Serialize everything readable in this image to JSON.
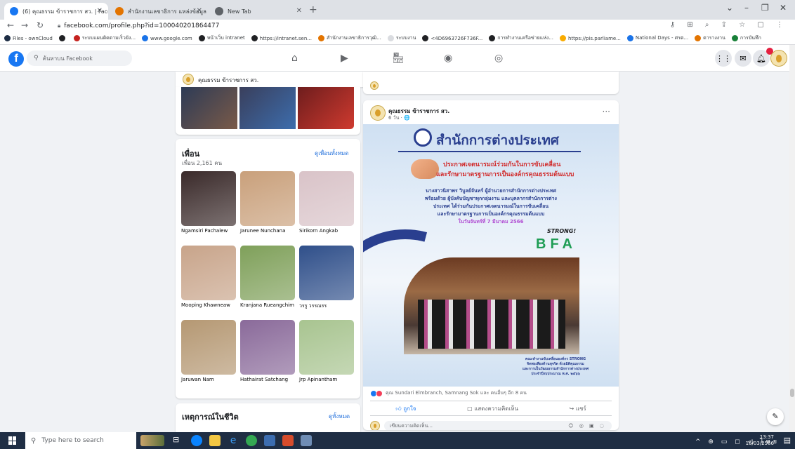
{
  "browser": {
    "tabs": [
      {
        "label": "(6) คุณธรรม ข้าราชการ สว. | Facebo",
        "active": true,
        "icon": "facebook-icon"
      },
      {
        "label": "สำนักงานเลขาธิการ แหล่งข้อมูล",
        "active": false,
        "icon": "parliament-icon"
      },
      {
        "label": "New Tab",
        "active": false,
        "icon": "chrome-icon"
      }
    ],
    "new_tab_label": "+",
    "url": "facebook.com/profile.php?id=100040201864477",
    "window_controls": [
      "⌄",
      "–",
      "❐",
      "✕"
    ],
    "bookmarks": [
      {
        "label": "Files - ownCloud",
        "color": "#1d2d44"
      },
      {
        "label": "",
        "color": "#202124"
      },
      {
        "label": "ระบบแผนติดตามเร็วยัง...",
        "color": "#c5221f"
      },
      {
        "label": "www.google.com",
        "color": "#1a73e8"
      },
      {
        "label": "หน้าเว็บ intranet",
        "color": "#202124"
      },
      {
        "label": "https://intranet.sen...",
        "color": "#202124"
      },
      {
        "label": "สำนักงานเลขาธิการวุฒิ...",
        "color": "#e37400"
      },
      {
        "label": "ระบบงาน",
        "color": "#dadce0"
      },
      {
        "label": "<4D6963726F736F...",
        "color": "#202124"
      },
      {
        "label": "การทำงานเครือข่ายแห่ง...",
        "color": "#202124"
      },
      {
        "label": "https://pis.parliame...",
        "color": "#f9ab00"
      },
      {
        "label": "National Days - ศรต...",
        "color": "#1a73e8"
      },
      {
        "label": "ตารางงาน",
        "color": "#e37400"
      },
      {
        "label": "การบันทึก",
        "color": "#188038"
      }
    ]
  },
  "facebook": {
    "search_placeholder": "ค้นหาบน Facebook",
    "profile_name": "คุณธรรม ข้าราชการ สว.",
    "sticky_more": "···",
    "friends": {
      "title": "เพื่อน",
      "count_text": "เพื่อน 2,161 คน",
      "see_all": "ดูเพื่อนทั้งหมด",
      "list": [
        {
          "name": "Ngamsiri Pachalew",
          "color": "#3a2a2a"
        },
        {
          "name": "Jarunee Nunchana",
          "color": "#c9a07b"
        },
        {
          "name": "Sirikorn Angkab",
          "color": "#d9c3c8"
        },
        {
          "name": "Mooping Khawneaw",
          "color": "#c8a48a"
        },
        {
          "name": "Kranjana Rueangchim",
          "color": "#7fa05a"
        },
        {
          "name": "วรรู วรรณรร",
          "color": "#2f4f8a"
        },
        {
          "name": "Jaruwan Nam",
          "color": "#b59873"
        },
        {
          "name": "Hathairat Satchang",
          "color": "#8a6a9a"
        },
        {
          "name": "Jrp Apinantham",
          "color": "#a8c490"
        }
      ]
    },
    "life_events": {
      "title": "เหตุการณ์ในชีวิต",
      "see_all": "ดูทั้งหมด"
    },
    "post": {
      "author": "คุณธรรม ข้าราชการ สว.",
      "time": "6 วัน · 🌐",
      "more": "···",
      "poster": {
        "org_title": "สำนักการต่างประเทศ",
        "headline_line1": "ประกาศเจตนารมณ์ร่วมกันในการขับเคลื่อน",
        "headline_line2": "และรักษามาตรฐานการเป็นองค์กรคุณธรรมต้นแบบ",
        "body_line1": "นางสาวนิสาพร วิบูลย์จันทร์ ผู้อำนวยการสำนักการต่างประเทศ",
        "body_line2": "พร้อมด้วย ผู้บังคับบัญชาทุกกลุ่มงาน และบุคลากรสำนักการต่าง",
        "body_line3": "ประเทศ ได้ร่วมกันประกาศเจตนารมณ์ในการขับเคลื่อน",
        "body_line4": "และรักษามาตรฐานการเป็นองค์กรคุณธรรมต้นแบบ",
        "date_line": "ในวันจันทร์ที่ 7 มีนาคม 2566",
        "strong": "STRONG!",
        "bfa": "BFA",
        "footer_line1": "คณะทำงานขับเคลื่อนองค์กร STRONG",
        "footer_line2": "จิตพอเพียงต้านทุจริต ด้วยมิติคุณธรรม",
        "footer_line3": "และการเป็นวัฒนธรรมสำนักการต่างประเทศ",
        "footer_line4": "ประจำปีงบประมาณ พ.ศ. ๒๕๖๖"
      },
      "reactions_text": "คุณ Sundari Elmbranch, Samnang Sok และ คนอื่นๆ อีก 8 คน",
      "like": "ถูกใจ",
      "comment": "แสดงความคิดเห็น",
      "share": "แชร์",
      "comment_placeholder": "เขียนความคิดเห็น..."
    }
  },
  "taskbar": {
    "search_placeholder": "Type here to search",
    "time": "13:37",
    "date": "16/03/2566",
    "tray_text": "^ ⊕ ▭ ◻ ◁ ไทย"
  },
  "colors": {
    "fb_blue": "#1877f2",
    "poster_blue": "#2a3f8f",
    "poster_red": "#d12b2b",
    "poster_purple": "#b04bd2"
  }
}
